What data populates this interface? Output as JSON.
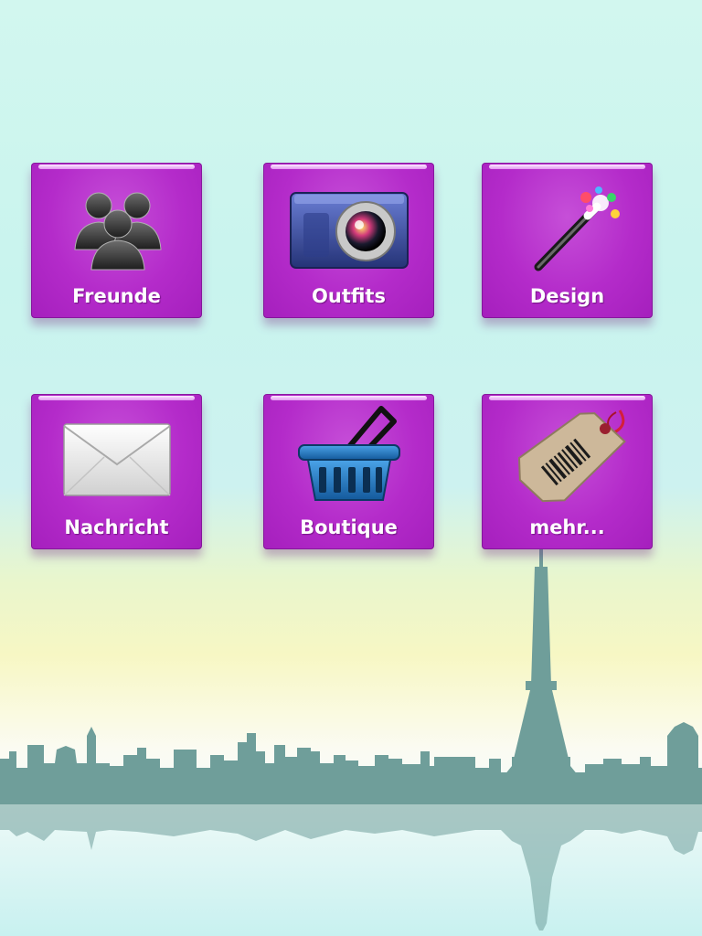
{
  "menu": {
    "items": [
      {
        "label": "Freunde",
        "icon": "friends-icon"
      },
      {
        "label": "Outfits",
        "icon": "camera-icon"
      },
      {
        "label": "Design",
        "icon": "magic-wand-icon"
      },
      {
        "label": "Nachricht",
        "icon": "envelope-icon"
      },
      {
        "label": "Boutique",
        "icon": "shopping-basket-icon"
      },
      {
        "label": "mehr...",
        "icon": "price-tag-icon"
      }
    ]
  },
  "colors": {
    "tile": "#b42bca",
    "tile_label": "#ffffff",
    "skyline": "#6f9e9a"
  },
  "background": "paris-skyline"
}
